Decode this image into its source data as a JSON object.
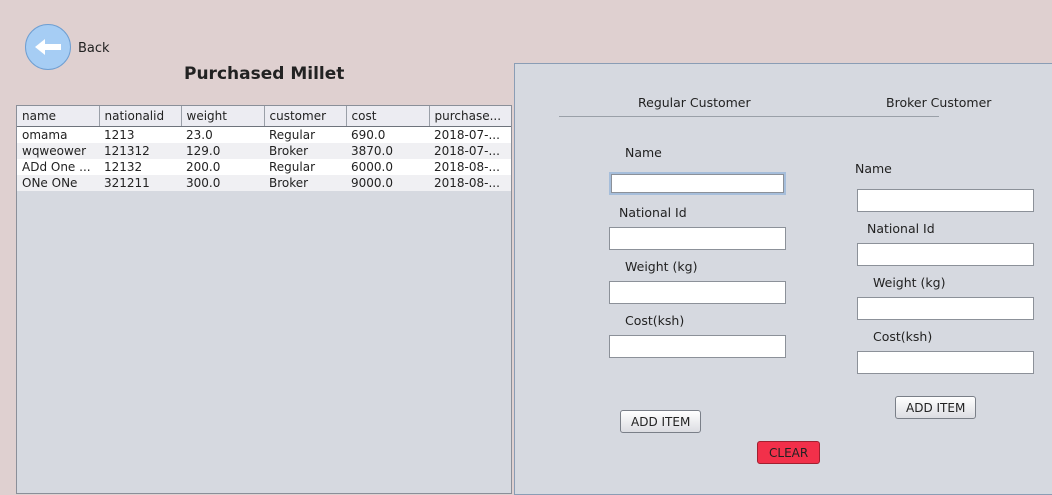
{
  "header": {
    "back_label": "Back",
    "page_title": "Purchased Millet"
  },
  "table": {
    "columns": [
      "name",
      "nationalid",
      "weight",
      "customer",
      "cost",
      "purchase..."
    ],
    "rows": [
      [
        "omama",
        "1213",
        "23.0",
        "Regular",
        "690.0",
        "2018-07-..."
      ],
      [
        "wqweower",
        "121312",
        "129.0",
        "Broker",
        "3870.0",
        "2018-07-..."
      ],
      [
        "ADd One ...",
        "12132",
        "200.0",
        "Regular",
        "6000.0",
        "2018-08-..."
      ],
      [
        "ONe ONe",
        "321211",
        "300.0",
        "Broker",
        "9000.0",
        "2018-08-..."
      ]
    ]
  },
  "form": {
    "regular": {
      "heading": "Regular Customer",
      "name_label": "Name",
      "national_id_label": "National Id",
      "weight_label": "Weight (kg)",
      "cost_label": "Cost(ksh)",
      "name_value": "",
      "national_id_value": "",
      "weight_value": "",
      "cost_value": "",
      "add_label": "ADD ITEM"
    },
    "broker": {
      "heading": "Broker Customer",
      "name_label": "Name",
      "national_id_label": "National Id",
      "weight_label": "Weight (kg)",
      "cost_label": "Cost(ksh)",
      "name_value": "",
      "national_id_value": "",
      "weight_value": "",
      "cost_value": "",
      "add_label": "ADD ITEM"
    },
    "clear_label": "CLEAR"
  },
  "colors": {
    "background": "#dfd0d0",
    "panel": "#d6d9e0",
    "back_button": "#a6cdf4",
    "clear_button": "#f2304a"
  }
}
